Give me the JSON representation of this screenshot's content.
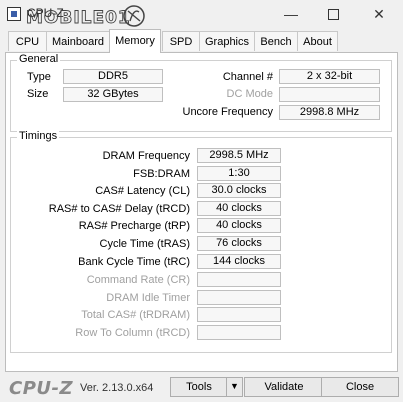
{
  "window": {
    "title": "CPU-Z",
    "watermark": "MOBILE01"
  },
  "tabs": [
    "CPU",
    "Mainboard",
    "Memory",
    "SPD",
    "Graphics",
    "Bench",
    "About"
  ],
  "general": {
    "title": "General",
    "type_label": "Type",
    "type_value": "DDR5",
    "size_label": "Size",
    "size_value": "32 GBytes",
    "channel_label": "Channel #",
    "channel_value": "2 x 32-bit",
    "dcmode_label": "DC Mode",
    "dcmode_value": "",
    "uncore_label": "Uncore Frequency",
    "uncore_value": "2998.8 MHz"
  },
  "timings": {
    "title": "Timings",
    "rows": [
      {
        "label": "DRAM Frequency",
        "value": "2998.5 MHz"
      },
      {
        "label": "FSB:DRAM",
        "value": "1:30"
      },
      {
        "label": "CAS# Latency (CL)",
        "value": "30.0 clocks"
      },
      {
        "label": "RAS# to CAS# Delay (tRCD)",
        "value": "40 clocks"
      },
      {
        "label": "RAS# Precharge (tRP)",
        "value": "40 clocks"
      },
      {
        "label": "Cycle Time (tRAS)",
        "value": "76 clocks"
      },
      {
        "label": "Bank Cycle Time (tRC)",
        "value": "144 clocks"
      },
      {
        "label": "Command Rate (CR)",
        "value": ""
      },
      {
        "label": "DRAM Idle Timer",
        "value": ""
      },
      {
        "label": "Total CAS# (tRDRAM)",
        "value": ""
      },
      {
        "label": "Row To Column (tRCD)",
        "value": ""
      }
    ]
  },
  "footer": {
    "logo": "CPU-Z",
    "version": "Ver. 2.13.0.x64",
    "tools_label": "Tools",
    "validate_label": "Validate",
    "close_label": "Close"
  }
}
